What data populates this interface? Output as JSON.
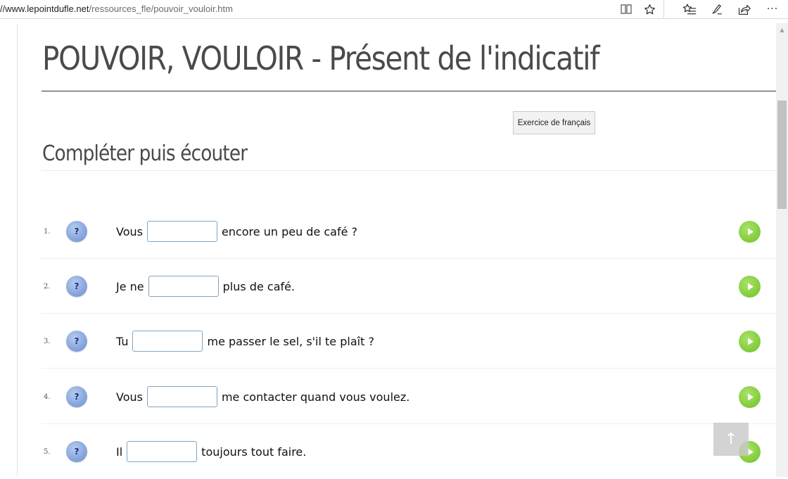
{
  "browser": {
    "url_domain": "//www.lepointdufle.net",
    "url_path": "/ressources_fle/pouvoir_vouloir.htm",
    "overflow_glyph": "···"
  },
  "page": {
    "title": "POUVOIR, VOULOIR - Présent de l'indicatif",
    "exercise_button": "Exercice de français",
    "section_title": "Compléter puis écouter",
    "hint_label": "?",
    "back_to_top": "↑"
  },
  "exercises": [
    {
      "number": "1.",
      "before": "Vous",
      "after": "encore un peu de café ?",
      "value": ""
    },
    {
      "number": "2.",
      "before": "Je ne",
      "after": "plus de café.",
      "value": ""
    },
    {
      "number": "3.",
      "before": "Tu",
      "after": "me passer le sel, s'il te plaît ?",
      "value": ""
    },
    {
      "number": "4.",
      "before": "Vous",
      "after": "me contacter quand vous voulez.",
      "value": ""
    },
    {
      "number": "5.",
      "before": "Il",
      "after": "toujours tout faire.",
      "value": ""
    }
  ],
  "colors": {
    "hint_button": "#8aa8df",
    "play_button": "#86cf3f",
    "input_border": "#7ea6c6"
  },
  "icons": {
    "reading_view": "book-icon",
    "favorite": "star-icon",
    "favorites_list": "favorites-list-icon",
    "notes": "pen-icon",
    "share": "share-icon",
    "more": "more-icon",
    "hint": "question-icon",
    "play": "play-icon",
    "back_to_top": "arrow-up-icon"
  }
}
